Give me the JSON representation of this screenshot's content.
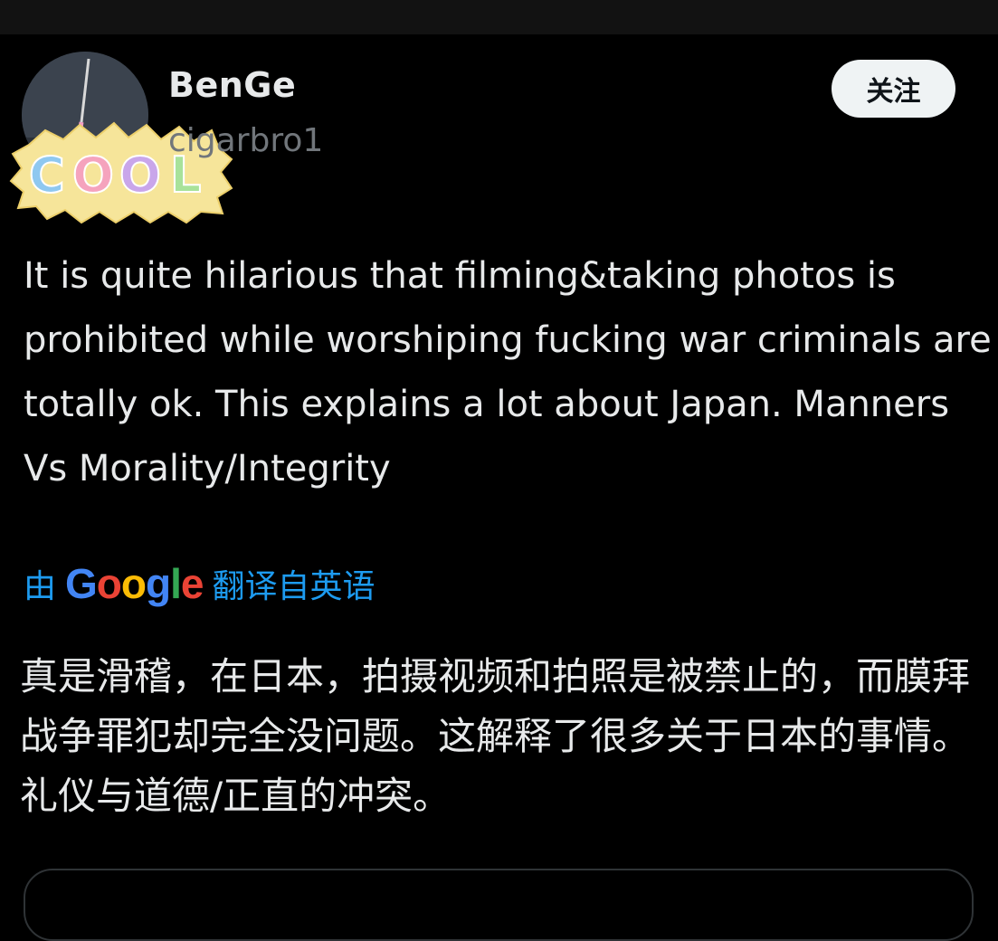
{
  "user": {
    "display_name": "BenGe",
    "handle": "cigarbro1",
    "avatar_sticker_text": "COOL"
  },
  "follow_button": {
    "label": "关注"
  },
  "tweet": {
    "text": "It is quite hilarious that filming&taking photos is prohibited while worshiping fucking war criminals are totally ok. This explains a lot about Japan. Manners Vs Morality/Integrity"
  },
  "translation": {
    "prefix": "由",
    "provider": "Google",
    "suffix": "翻译自英语",
    "text": "真是滑稽，在日本，拍摄视频和拍照是被禁止的，而膜拜战争罪犯却完全没问题。这解释了很多关于日本的事情。礼仪与道德/正直的冲突。"
  },
  "colors": {
    "background": "#000000",
    "text": "#e7e9ea",
    "secondary_text": "#71767b",
    "link": "#1d9bf0",
    "button_bg": "#eff3f4"
  }
}
